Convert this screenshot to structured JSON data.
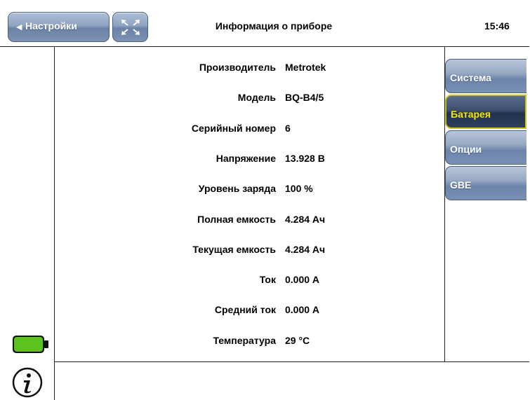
{
  "header": {
    "back_label": "Настройки",
    "title": "Информация о приборе",
    "time": "15:46"
  },
  "device_info": [
    {
      "label": "Производитель",
      "value": "Metrotek"
    },
    {
      "label": "Модель",
      "value": "BQ-B4/5"
    },
    {
      "label": "Серийный номер",
      "value": "6"
    },
    {
      "label": "Напряжение",
      "value": "13.928 В"
    },
    {
      "label": "Уровень заряда",
      "value": "100 %"
    },
    {
      "label": "Полная емкость",
      "value": "4.284 Ач"
    },
    {
      "label": "Текущая емкость",
      "value": "4.284 Ач"
    },
    {
      "label": "Ток",
      "value": "0.000 А"
    },
    {
      "label": "Средний ток",
      "value": "0.000 А"
    },
    {
      "label": "Температура",
      "value": "29 °C"
    }
  ],
  "tabs": [
    {
      "label": "Система",
      "active": false
    },
    {
      "label": "Батарея",
      "active": true
    },
    {
      "label": "Опции",
      "active": false
    },
    {
      "label": "GBE",
      "active": false
    }
  ],
  "status": {
    "battery_icon": "battery-icon",
    "battery_level": 1.0,
    "info_icon": "info-icon"
  },
  "colors": {
    "button_blue": "#8fa4c2",
    "active_tab": "#2e4060",
    "active_text": "#f5e800",
    "battery_green": "#5cc21e"
  }
}
